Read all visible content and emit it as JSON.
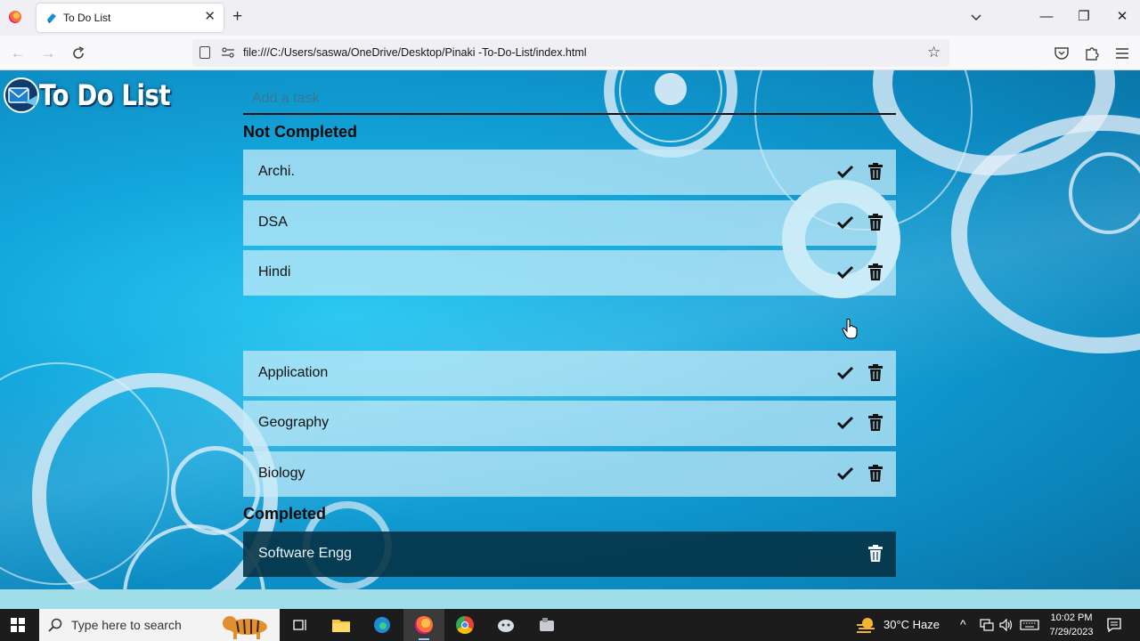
{
  "browser": {
    "tab_title": "To Do List",
    "url": "file:///C:/Users/saswa/OneDrive/Desktop/Pinaki -To-Do-List/index.html",
    "icons": {
      "menu": "firefox-logo-icon",
      "tab_close": "close-icon",
      "new_tab": "plus-icon",
      "list_tabs": "chevron-down-icon",
      "back": "arrow-left-icon",
      "forward": "arrow-right-icon",
      "reload": "reload-icon",
      "bookmark": "star-icon",
      "pocket": "pocket-icon",
      "extensions": "puzzle-icon",
      "menu_button": "hamburger-icon"
    }
  },
  "app": {
    "logo_text": "To Do List",
    "input_placeholder": "Add a task",
    "not_completed_heading": "Not Completed",
    "completed_heading": "Completed",
    "not_completed": [
      {
        "label": "Archi."
      },
      {
        "label": "DSA"
      },
      {
        "label": "Hindi"
      },
      {
        "label": "Application"
      },
      {
        "label": "Geography"
      },
      {
        "label": "Biology"
      }
    ],
    "completed": [
      {
        "label": "Software Engg"
      }
    ],
    "colors": {
      "background": "#13a6dc",
      "task_row": "#c8ebf8",
      "completed_row": "#043042"
    }
  },
  "taskbar": {
    "search_placeholder": "Type here to search",
    "weather": "30°C  Haze",
    "time": "10:02 PM",
    "date": "7/29/2023"
  }
}
